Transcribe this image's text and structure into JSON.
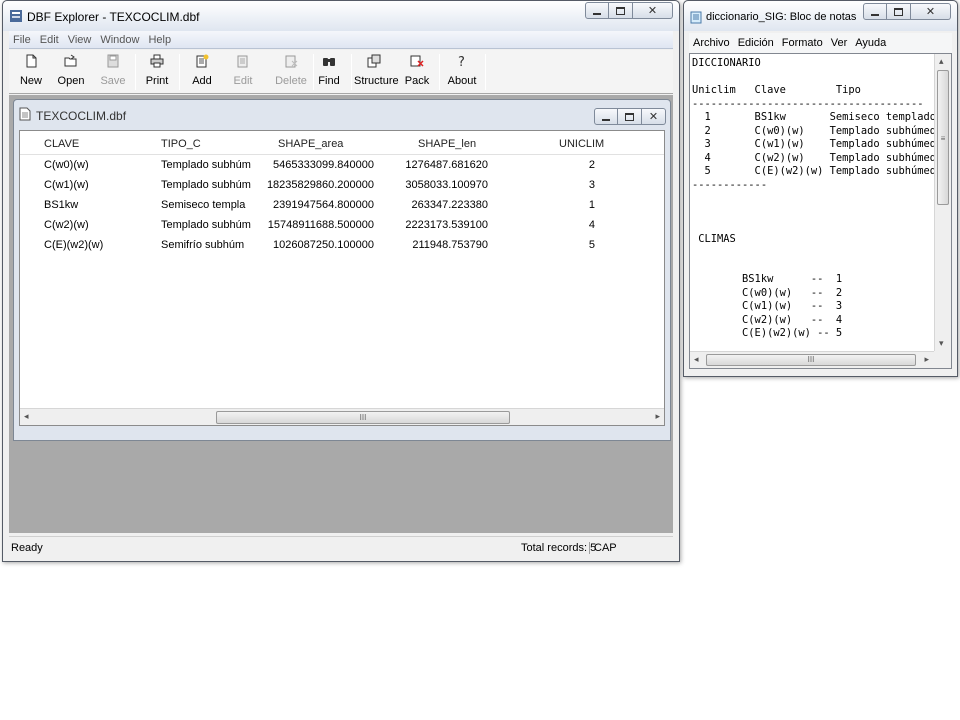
{
  "dbf_window": {
    "title": "DBF Explorer - TEXCOCLIM.dbf",
    "menu": [
      "File",
      "Edit",
      "View",
      "Window",
      "Help"
    ],
    "toolbar": {
      "new": "New",
      "open": "Open",
      "save": "Save",
      "print": "Print",
      "add": "Add",
      "edit": "Edit",
      "delete": "Delete",
      "find": "Find",
      "structure": "Structure",
      "pack": "Pack",
      "about": "About"
    },
    "table_window": {
      "title": "TEXCOCLIM.dbf",
      "columns": [
        "CLAVE",
        "TIPO_C",
        "SHAPE_area",
        "SHAPE_len",
        "UNICLIM"
      ],
      "rows": [
        [
          "C(w0)(w)",
          "Templado subhúm",
          "5465333099.840000",
          "1276487.681620",
          "2"
        ],
        [
          "C(w1)(w)",
          "Templado subhúm",
          "18235829860.200000",
          "3058033.100970",
          "3"
        ],
        [
          "BS1kw",
          "Semiseco templa",
          "2391947564.800000",
          "263347.223380",
          "1"
        ],
        [
          "C(w2)(w)",
          "Templado subhúm",
          "15748911688.500000",
          "2223173.539100",
          "4"
        ],
        [
          "C(E)(w2)(w)",
          "Semifrío subhúm",
          "1026087250.100000",
          "211948.753790",
          "5"
        ]
      ]
    },
    "status": {
      "ready": "Ready",
      "total": "Total records: 5",
      "cap": "CAP"
    },
    "scroll_glyph": "III"
  },
  "notepad_window": {
    "title": "diccionario_SIG: Bloc de notas",
    "menu": [
      "Archivo",
      "Edición",
      "Formato",
      "Ver",
      "Ayuda"
    ],
    "text": "DICCIONARIO\n\nUniclim   Clave        Tipo\n-------------------------------------\n  1       BS1kw       Semiseco templado\n  2       C(w0)(w)    Templado subhúmedo\n  3       C(w1)(w)    Templado subhúmedo\n  4       C(w2)(w)    Templado subhúmedo\n  5       C(E)(w2)(w) Templado subhúmedo\n------------\n\n\n\n CLIMAS\n\n\n        BS1kw      --  1\n        C(w0)(w)   --  2\n        C(w1)(w)   --  3\n        C(w2)(w)   --  4\n        C(E)(w2)(w) -- 5"
  },
  "colors": {
    "mdi_background": "#a9a9a9",
    "title_gradient_top": "#ffffff",
    "title_gradient_bottom": "#dfe6f0",
    "close_button": "#c9483f"
  }
}
